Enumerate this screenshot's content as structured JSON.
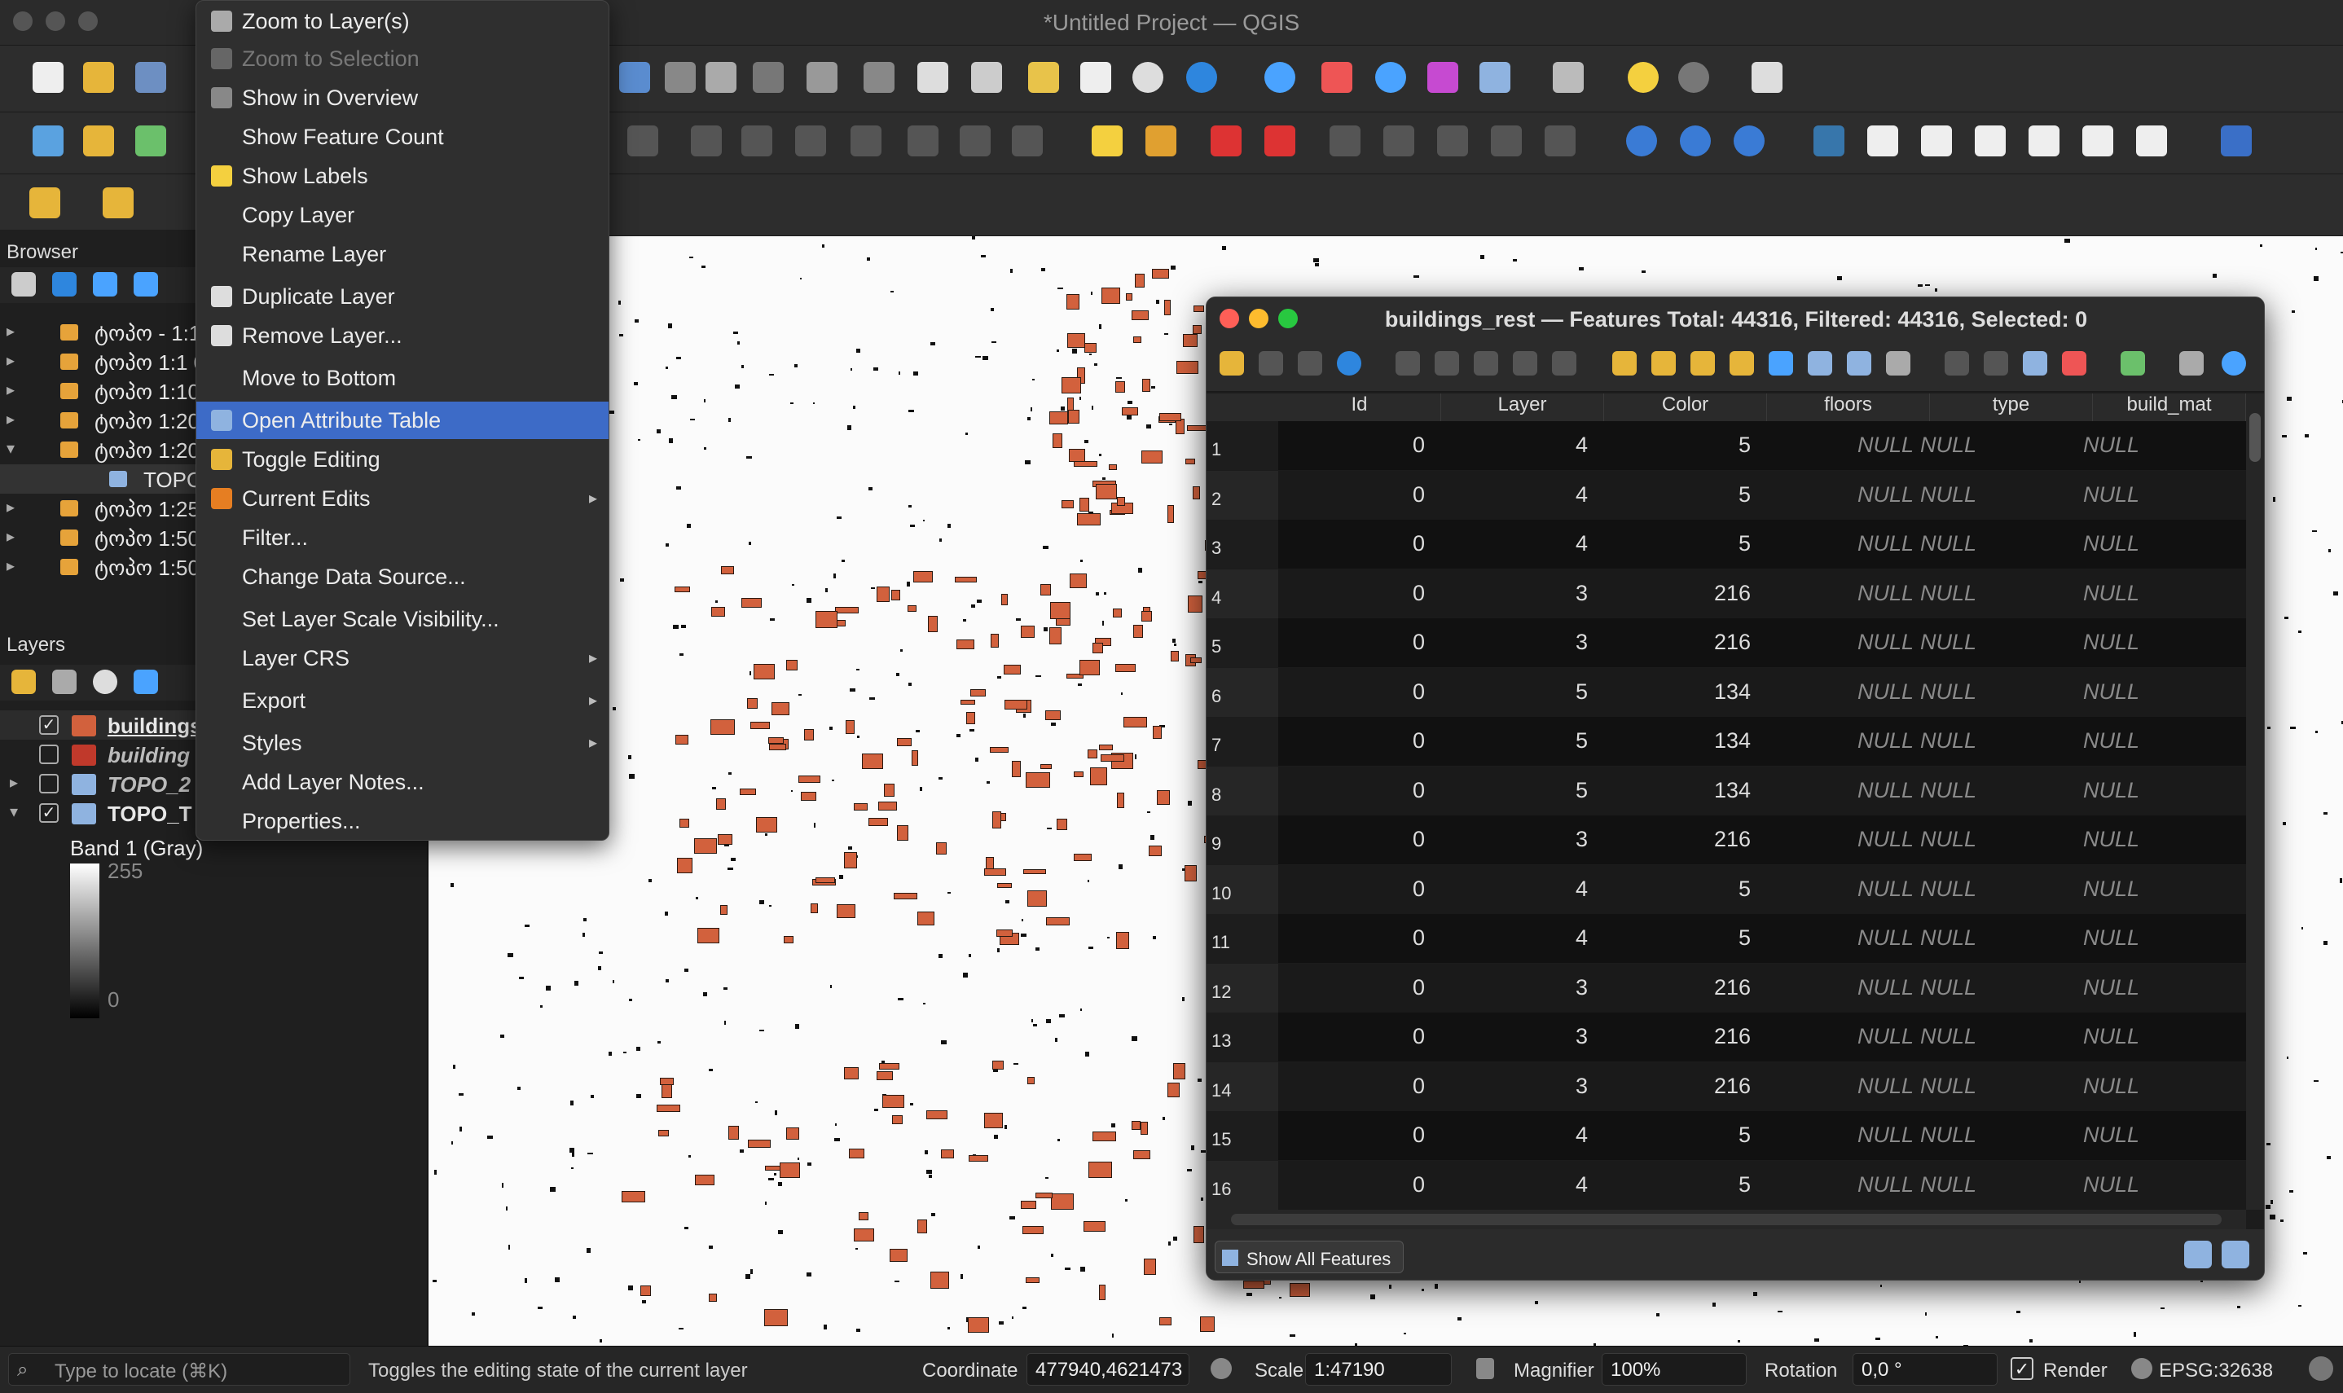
{
  "window": {
    "title": "*Untitled Project — QGIS"
  },
  "browser_panel": {
    "title": "Browser",
    "items": [
      "ტოპო - 1:1",
      "ტოპო 1:1 0",
      "ტოპო 1:10",
      "ტოპო 1:20",
      "ტოპო 1:20",
      "TOPO_",
      "ტოპო 1:25",
      "ტოპო 1:50",
      "ტოპო 1:50"
    ]
  },
  "layers_panel": {
    "title": "Layers",
    "layers": [
      {
        "name": "buildings",
        "checked": true
      },
      {
        "name": "building",
        "checked": false
      },
      {
        "name": "TOPO_2",
        "checked": false
      },
      {
        "name": "TOPO_T",
        "checked": true
      }
    ],
    "band_label": "Band 1 (Gray)",
    "legend_max": "255",
    "legend_min": "0"
  },
  "context_menu": {
    "items": [
      {
        "label": "Zoom to Layer(s)",
        "icon": "zoom-layer-icon",
        "state": "normal"
      },
      {
        "label": "Zoom to Selection",
        "icon": "zoom-selection-icon",
        "state": "disabled"
      },
      {
        "label": "Show in Overview",
        "icon": "overview-icon",
        "state": "normal"
      },
      {
        "label": "Show Feature Count",
        "icon": "",
        "state": "normal"
      },
      {
        "label": "Show Labels",
        "icon": "labels-icon",
        "state": "normal"
      },
      {
        "label": "Copy Layer",
        "icon": "",
        "state": "normal"
      },
      {
        "label": "Rename Layer",
        "icon": "",
        "state": "normal"
      },
      {
        "label": "Duplicate Layer",
        "icon": "duplicate-icon",
        "state": "normal"
      },
      {
        "label": "Remove Layer...",
        "icon": "remove-icon",
        "state": "normal"
      },
      {
        "label": "Move to Bottom",
        "icon": "",
        "state": "normal"
      },
      {
        "label": "Open Attribute Table",
        "icon": "table-icon",
        "state": "selected"
      },
      {
        "label": "Toggle Editing",
        "icon": "pencil-icon",
        "state": "normal"
      },
      {
        "label": "Current Edits",
        "icon": "edits-icon",
        "state": "submenu"
      },
      {
        "label": "Filter...",
        "icon": "",
        "state": "normal"
      },
      {
        "label": "Change Data Source...",
        "icon": "",
        "state": "normal"
      },
      {
        "label": "Set Layer Scale Visibility...",
        "icon": "",
        "state": "normal"
      },
      {
        "label": "Layer CRS",
        "icon": "",
        "state": "submenu"
      },
      {
        "label": "Export",
        "icon": "",
        "state": "submenu"
      },
      {
        "label": "Styles",
        "icon": "",
        "state": "submenu"
      },
      {
        "label": "Add Layer Notes...",
        "icon": "",
        "state": "normal"
      },
      {
        "label": "Properties...",
        "icon": "",
        "state": "normal"
      }
    ]
  },
  "attribute_table": {
    "title": "buildings_rest — Features Total: 44316, Filtered: 44316, Selected: 0",
    "columns": [
      "Id",
      "Layer",
      "Color",
      "floors",
      "type",
      "build_mat"
    ],
    "rows": [
      {
        "n": "1",
        "id": "0",
        "layer": "4",
        "color": "5",
        "floors": "NULL",
        "type": "NULL",
        "build_mat": "NULL"
      },
      {
        "n": "2",
        "id": "0",
        "layer": "4",
        "color": "5",
        "floors": "NULL",
        "type": "NULL",
        "build_mat": "NULL"
      },
      {
        "n": "3",
        "id": "0",
        "layer": "4",
        "color": "5",
        "floors": "NULL",
        "type": "NULL",
        "build_mat": "NULL"
      },
      {
        "n": "4",
        "id": "0",
        "layer": "3",
        "color": "216",
        "floors": "NULL",
        "type": "NULL",
        "build_mat": "NULL"
      },
      {
        "n": "5",
        "id": "0",
        "layer": "3",
        "color": "216",
        "floors": "NULL",
        "type": "NULL",
        "build_mat": "NULL"
      },
      {
        "n": "6",
        "id": "0",
        "layer": "5",
        "color": "134",
        "floors": "NULL",
        "type": "NULL",
        "build_mat": "NULL"
      },
      {
        "n": "7",
        "id": "0",
        "layer": "5",
        "color": "134",
        "floors": "NULL",
        "type": "NULL",
        "build_mat": "NULL"
      },
      {
        "n": "8",
        "id": "0",
        "layer": "5",
        "color": "134",
        "floors": "NULL",
        "type": "NULL",
        "build_mat": "NULL"
      },
      {
        "n": "9",
        "id": "0",
        "layer": "3",
        "color": "216",
        "floors": "NULL",
        "type": "NULL",
        "build_mat": "NULL"
      },
      {
        "n": "10",
        "id": "0",
        "layer": "4",
        "color": "5",
        "floors": "NULL",
        "type": "NULL",
        "build_mat": "NULL"
      },
      {
        "n": "11",
        "id": "0",
        "layer": "4",
        "color": "5",
        "floors": "NULL",
        "type": "NULL",
        "build_mat": "NULL"
      },
      {
        "n": "12",
        "id": "0",
        "layer": "3",
        "color": "216",
        "floors": "NULL",
        "type": "NULL",
        "build_mat": "NULL"
      },
      {
        "n": "13",
        "id": "0",
        "layer": "3",
        "color": "216",
        "floors": "NULL",
        "type": "NULL",
        "build_mat": "NULL"
      },
      {
        "n": "14",
        "id": "0",
        "layer": "3",
        "color": "216",
        "floors": "NULL",
        "type": "NULL",
        "build_mat": "NULL"
      },
      {
        "n": "15",
        "id": "0",
        "layer": "4",
        "color": "5",
        "floors": "NULL",
        "type": "NULL",
        "build_mat": "NULL"
      },
      {
        "n": "16",
        "id": "0",
        "layer": "4",
        "color": "5",
        "floors": "NULL",
        "type": "NULL",
        "build_mat": "NULL"
      }
    ],
    "filter_button": "Show All Features"
  },
  "status_bar": {
    "locate_placeholder": "Type to locate (⌘K)",
    "message": "Toggles the editing state of the current layer",
    "coordinate_label": "Coordinate",
    "coordinate_value": "477940,4621473",
    "scale_label": "Scale",
    "scale_value": "1:47190",
    "magnifier_label": "Magnifier",
    "magnifier_value": "100%",
    "rotation_label": "Rotation",
    "rotation_value": "0,0 °",
    "render_label": "Render",
    "crs": "EPSG:32638"
  },
  "colors": {
    "selection": "#3d6bc7",
    "buildings": "#d2613d",
    "panel": "#1f1f1f"
  }
}
